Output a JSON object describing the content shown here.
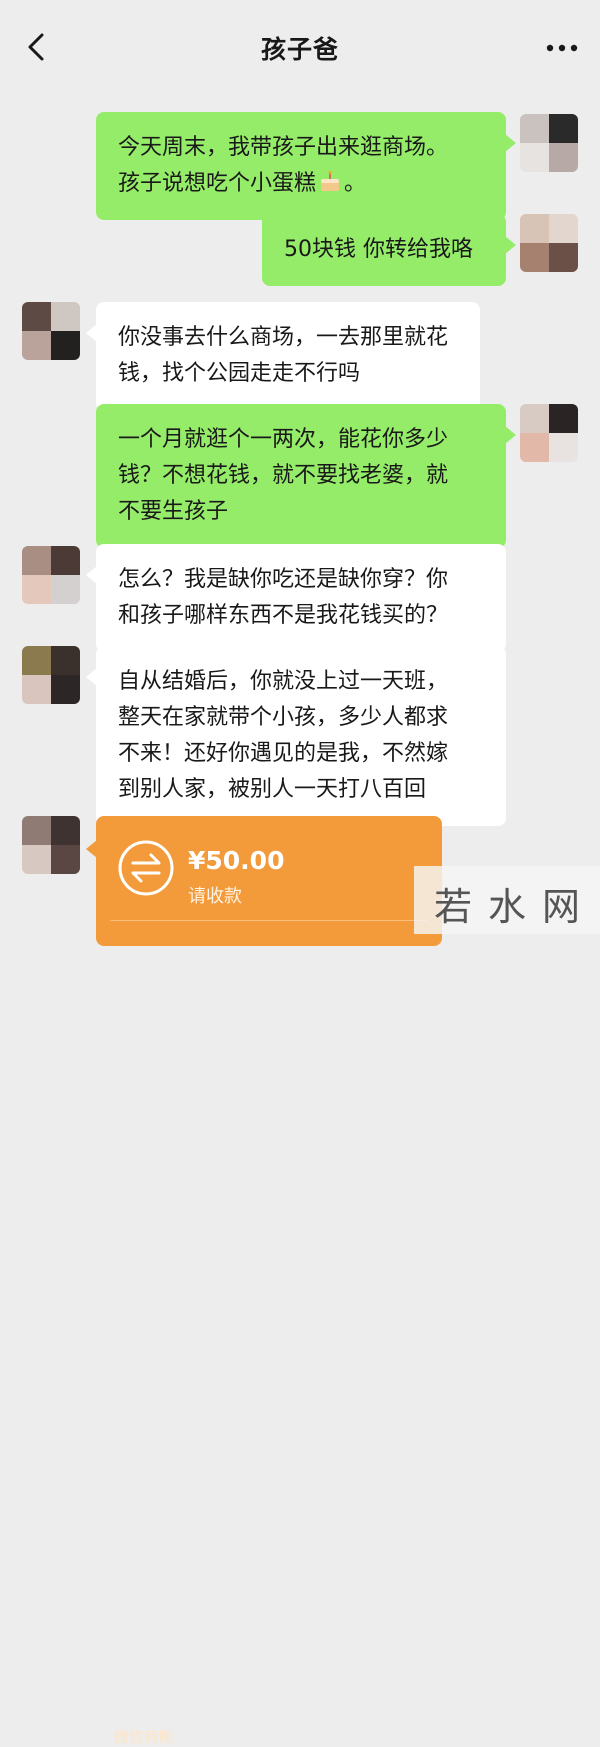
{
  "header": {
    "title": "孩子爸"
  },
  "messages": [
    {
      "side": "right",
      "lines": [
        "今天周末，我带孩子出来逛商场。",
        "孩子说想吃个小蛋糕",
        "。"
      ]
    },
    {
      "side": "right",
      "lines": [
        "50块钱 你转给我咯"
      ]
    },
    {
      "side": "left",
      "lines": [
        "你没事去什么商场，一去那里就花",
        "钱，找个公园走走不行吗"
      ]
    },
    {
      "side": "right",
      "lines": [
        "一个月就逛个一两次，能花你多少",
        "钱？不想花钱，就不要找老婆，就",
        "不要生孩子"
      ]
    },
    {
      "side": "left",
      "lines": [
        "怎么？我是缺你吃还是缺你穿？你",
        "和孩子哪样东西不是我花钱买的？"
      ]
    },
    {
      "side": "left",
      "lines": [
        "自从结婚后，你就没上过一天班，",
        "整天在家就带个小孩，多少人都求",
        "不来！还好你遇见的是我，不然嫁",
        "到别人家，被别人一天打八百回"
      ]
    }
  ],
  "transfer": {
    "amount": "¥50.00",
    "status": "请收款",
    "footer": "微信转账"
  },
  "watermark": {
    "text": "若水网"
  },
  "colors": {
    "background": "#ededed",
    "sent_bubble": "#95ec69",
    "received_bubble": "#ffffff",
    "transfer_card": "#f39b3a"
  },
  "icons": {
    "back": "chevron-left-icon",
    "more": "more-dots-icon",
    "cake": "cake-emoji-icon",
    "transfer": "transfer-arrows-icon"
  }
}
